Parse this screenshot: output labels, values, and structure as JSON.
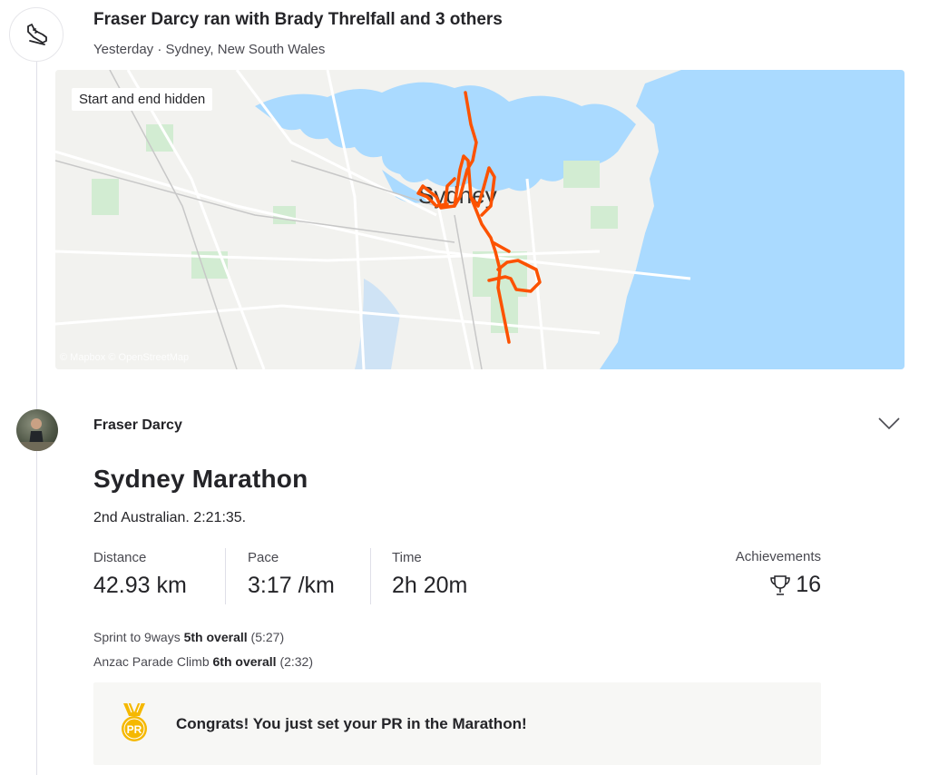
{
  "group": {
    "title": "Fraser Darcy ran with Brady Threlfall and 3 others",
    "subtitle": "Yesterday · Sydney, New South Wales"
  },
  "map": {
    "hidden_label": "Start and end hidden",
    "city_label": "Sydney",
    "attribution": "© Mapbox © OpenStreetMap",
    "route_color": "#fc5200",
    "water_color": "#aadaff"
  },
  "activity": {
    "athlete": "Fraser Darcy",
    "title": "Sydney Marathon",
    "description": "2nd Australian. 2:21:35.",
    "stats": [
      {
        "label": "Distance",
        "value": "42.93 km"
      },
      {
        "label": "Pace",
        "value": "3:17 /km"
      },
      {
        "label": "Time",
        "value": "2h 20m"
      }
    ],
    "achievements": {
      "label": "Achievements",
      "value": "16"
    },
    "segments": [
      {
        "name": "Sprint to 9ways",
        "rank": "5th overall",
        "time": "(5:27)"
      },
      {
        "name": "Anzac Parade Climb",
        "rank": "6th overall",
        "time": "(2:32)"
      }
    ],
    "pr": {
      "badge": "PR",
      "message": "Congrats! You just set your PR in the Marathon!"
    }
  },
  "colors": {
    "accent": "#fc5200",
    "medal": "#f5b800"
  }
}
